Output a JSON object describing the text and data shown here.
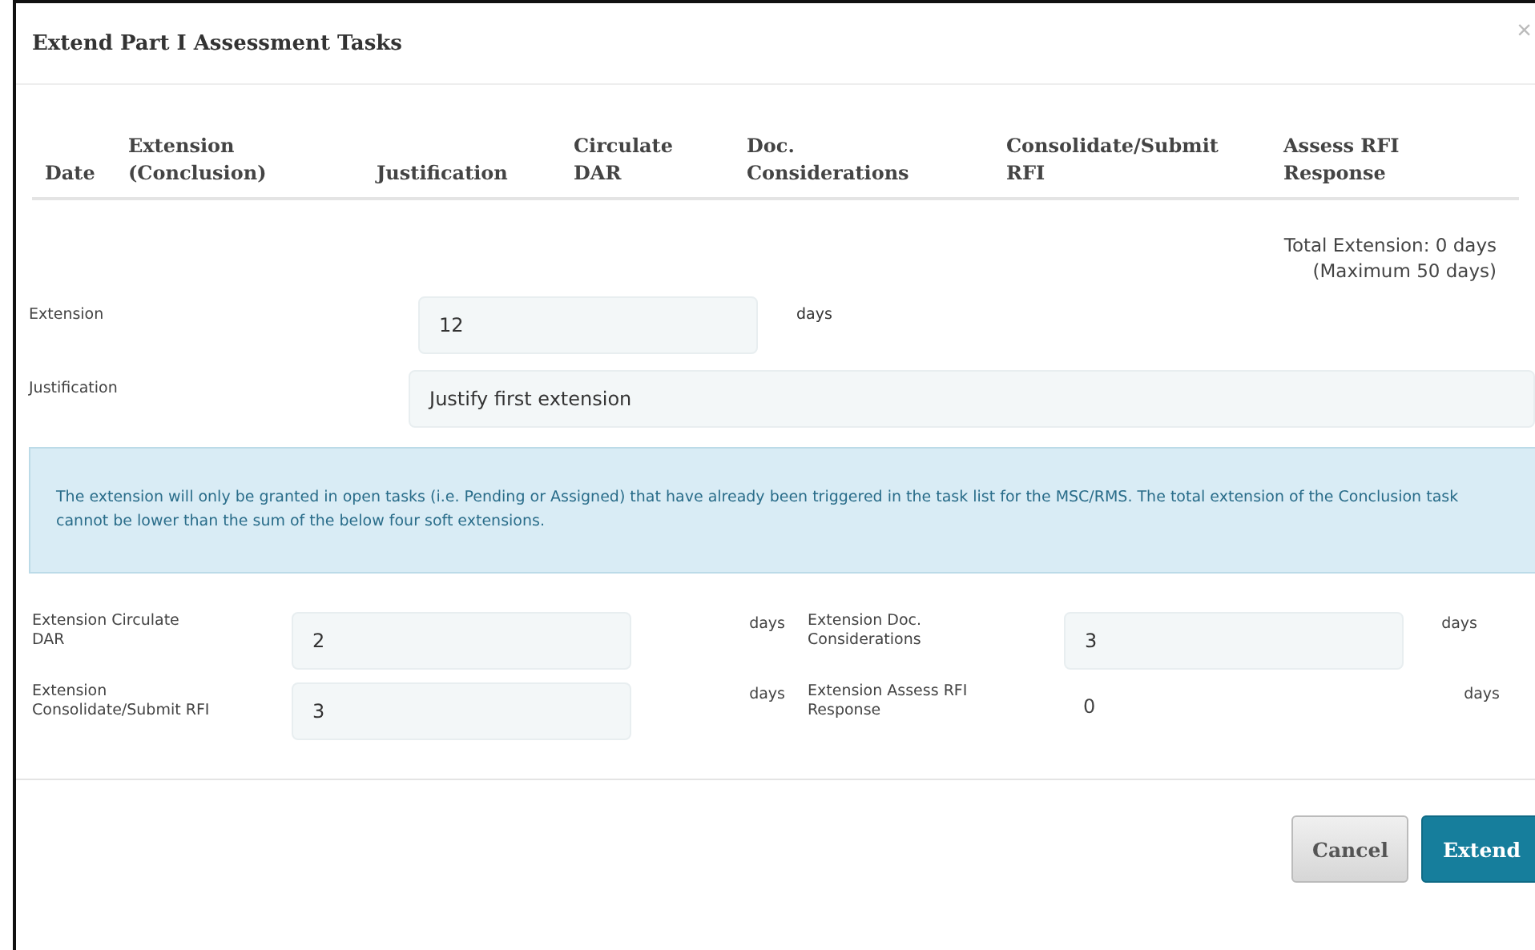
{
  "dialog": {
    "title": "Extend Part I Assessment Tasks",
    "close": "×"
  },
  "table": {
    "columns": [
      "Date",
      "Extension (Conclusion)",
      "Justification",
      "Circulate DAR",
      "Doc. Considerations",
      "Consolidate/Submit RFI",
      "Assess RFI Response"
    ]
  },
  "total": {
    "text": "Total Extension: 0 days",
    "maximum": "(Maximum 50 days)"
  },
  "fields": [
    {
      "label": "Extension",
      "value": "12",
      "unit": "days"
    },
    {
      "label": "Justification",
      "value": "Justify first extension"
    }
  ],
  "info": "The extension will only be granted in open tasks (i.e. Pending or Assigned) that have already been triggered in the task list for the MSC/RMS. The total extension of the Conclusion task cannot be lower than the sum of the below four soft extensions.",
  "soft_extensions": [
    {
      "label": "Extension Circulate DAR",
      "value": "2",
      "unit": "days",
      "kind": "input"
    },
    {
      "label": "Extension Doc. Considerations",
      "value": "3",
      "unit": "days",
      "kind": "input"
    },
    {
      "label": "Extension Consolidate/Submit RFI",
      "value": "3",
      "unit": "days",
      "kind": "input"
    },
    {
      "label": "Extension Assess RFI Response",
      "value": "0",
      "unit": "days",
      "kind": "text"
    }
  ],
  "buttons": [
    {
      "label": "Cancel",
      "kind": "secondary"
    },
    {
      "label": "Extend",
      "kind": "primary"
    }
  ]
}
